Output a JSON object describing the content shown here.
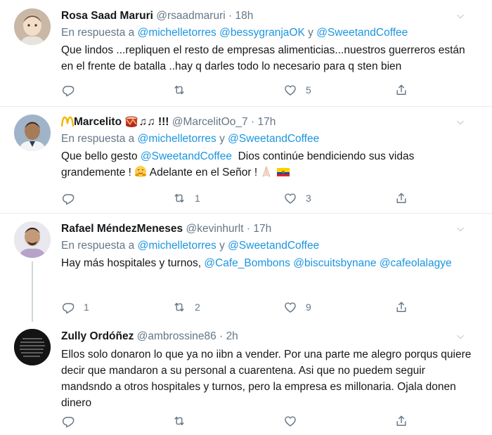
{
  "tweets": [
    {
      "name": "Rosa Saad Maruri",
      "handle": "@rsaadmaruri",
      "time": "18h",
      "reply_prefix": "En respuesta a",
      "reply_users": [
        "@michelletorres",
        "@bessygranjaOK"
      ],
      "reply_and": "y",
      "reply_last": "@SweetandCoffee",
      "text": "Que lindos ...repliquen el resto de empresas alimenticias...nuestros guerreros están en el frente de batalla ..hay q darles todo lo necesario para q sten bien",
      "replies": "",
      "retweets": "",
      "likes": "5"
    },
    {
      "name": "Marcelito",
      "name_suffix": "!!!",
      "handle": "@MarcelitOo_7",
      "time": "17h",
      "reply_prefix": "En respuesta a",
      "reply_users": [
        "@michelletorres"
      ],
      "reply_and": "y",
      "reply_last": "@SweetandCoffee",
      "text_a": "Que bello gesto",
      "text_link": "@SweetandCoffee",
      "text_b": "Dios continúe bendiciendo sus vidas grandemente !",
      "text_c": "Adelante en el Señor !",
      "replies": "",
      "retweets": "1",
      "likes": "3"
    },
    {
      "name": "Rafael MéndezMeneses",
      "handle": "@kevinhurlt",
      "time": "17h",
      "reply_prefix": "En respuesta a",
      "reply_users": [
        "@michelletorres"
      ],
      "reply_and": "y",
      "reply_last": "@SweetandCoffee",
      "text_a": "Hay más hospitales y turnos,",
      "text_links": [
        "@Cafe_Bombons",
        "@biscuitsbynane",
        "@cafeolalagye"
      ],
      "replies": "1",
      "retweets": "2",
      "likes": "9"
    },
    {
      "name": "Zully Ordóñez",
      "handle": "@ambrossine86",
      "time": "2h",
      "text": "Ellos solo donaron lo que ya no iibn a vender. Por una parte me alegro porqus quiere decir que mandaron a su personal a cuarentena. Asi que no puedem seguir mandsndo a otros hospitales y turnos, pero la empresa es millonaria. Ojala donen dinero",
      "replies": "",
      "retweets": "",
      "likes": ""
    }
  ],
  "icons": [
    "reply-icon",
    "retweet-icon",
    "like-icon",
    "share-icon",
    "caret-down-icon"
  ],
  "colors": {
    "link": "#1b95e0",
    "muted": "#657786",
    "text": "#14171a",
    "divider": "#e6ecf0"
  }
}
